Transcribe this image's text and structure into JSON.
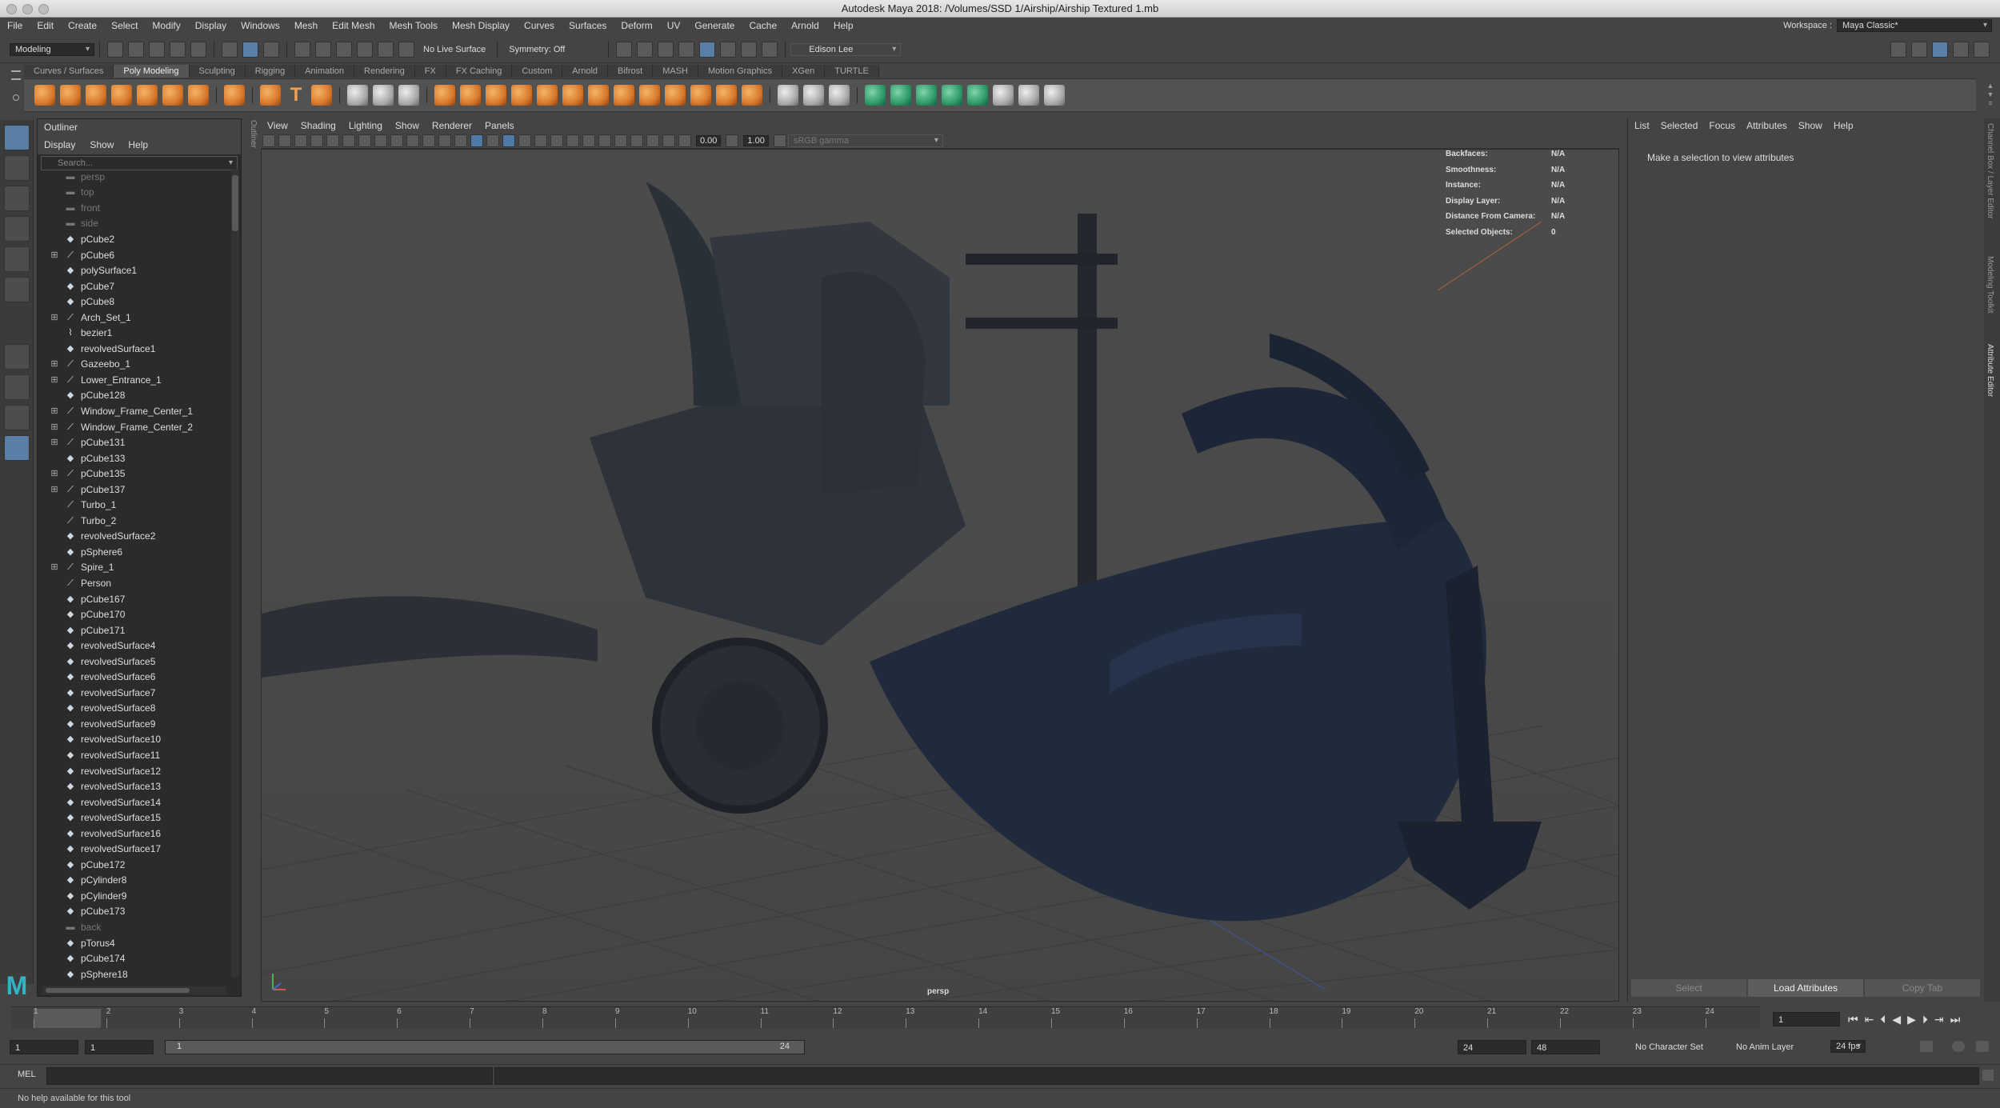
{
  "window": {
    "title": "Autodesk Maya 2018: /Volumes/SSD 1/Airship/Airship Textured 1.mb"
  },
  "menubar": {
    "items": [
      "File",
      "Edit",
      "Create",
      "Select",
      "Modify",
      "Display",
      "Windows",
      "Mesh",
      "Edit Mesh",
      "Mesh Tools",
      "Mesh Display",
      "Curves",
      "Surfaces",
      "Deform",
      "UV",
      "Generate",
      "Cache",
      "Arnold",
      "Help"
    ],
    "workspace_label": "Workspace :",
    "workspace_value": "Maya Classic*"
  },
  "statusline": {
    "menuset": "Modeling",
    "live_surface": "No Live Surface",
    "symmetry": "Symmetry: Off",
    "user": "Edison Lee"
  },
  "shelf": {
    "tabs": [
      "Curves / Surfaces",
      "Poly Modeling",
      "Sculpting",
      "Rigging",
      "Animation",
      "Rendering",
      "FX",
      "FX Caching",
      "Custom",
      "Arnold",
      "Bifrost",
      "MASH",
      "Motion Graphics",
      "XGen",
      "TURTLE"
    ],
    "active_tab": "Poly Modeling"
  },
  "outliner": {
    "title": "Outliner",
    "menus": [
      "Display",
      "Show",
      "Help"
    ],
    "search_placeholder": "Search...",
    "items": [
      {
        "name": "persp",
        "type": "camera",
        "expand": false,
        "dim": true
      },
      {
        "name": "top",
        "type": "camera",
        "expand": false,
        "dim": true
      },
      {
        "name": "front",
        "type": "camera",
        "expand": false,
        "dim": true
      },
      {
        "name": "side",
        "type": "camera",
        "expand": false,
        "dim": true
      },
      {
        "name": "pCube2",
        "type": "mesh",
        "expand": false
      },
      {
        "name": "pCube6",
        "type": "group",
        "expand": true
      },
      {
        "name": "polySurface1",
        "type": "mesh",
        "expand": false
      },
      {
        "name": "pCube7",
        "type": "mesh",
        "expand": false
      },
      {
        "name": "pCube8",
        "type": "mesh",
        "expand": false
      },
      {
        "name": "Arch_Set_1",
        "type": "group",
        "expand": true
      },
      {
        "name": "bezier1",
        "type": "curve",
        "expand": false
      },
      {
        "name": "revolvedSurface1",
        "type": "mesh",
        "expand": false
      },
      {
        "name": "Gazeebo_1",
        "type": "group",
        "expand": true
      },
      {
        "name": "Lower_Entrance_1",
        "type": "group",
        "expand": true
      },
      {
        "name": "pCube128",
        "type": "mesh",
        "expand": false
      },
      {
        "name": "Window_Frame_Center_1",
        "type": "group",
        "expand": true
      },
      {
        "name": "Window_Frame_Center_2",
        "type": "group",
        "expand": true
      },
      {
        "name": "pCube131",
        "type": "group",
        "expand": true
      },
      {
        "name": "pCube133",
        "type": "mesh",
        "expand": false
      },
      {
        "name": "pCube135",
        "type": "group",
        "expand": true
      },
      {
        "name": "pCube137",
        "type": "group",
        "expand": true
      },
      {
        "name": "Turbo_1",
        "type": "group",
        "expand": false
      },
      {
        "name": "Turbo_2",
        "type": "group",
        "expand": false
      },
      {
        "name": "revolvedSurface2",
        "type": "mesh",
        "expand": false
      },
      {
        "name": "pSphere6",
        "type": "mesh",
        "expand": false
      },
      {
        "name": "Spire_1",
        "type": "group",
        "expand": true
      },
      {
        "name": "Person",
        "type": "group",
        "expand": false
      },
      {
        "name": "pCube167",
        "type": "mesh",
        "expand": false
      },
      {
        "name": "pCube170",
        "type": "mesh",
        "expand": false
      },
      {
        "name": "pCube171",
        "type": "mesh",
        "expand": false
      },
      {
        "name": "revolvedSurface4",
        "type": "mesh",
        "expand": false
      },
      {
        "name": "revolvedSurface5",
        "type": "mesh",
        "expand": false
      },
      {
        "name": "revolvedSurface6",
        "type": "mesh",
        "expand": false
      },
      {
        "name": "revolvedSurface7",
        "type": "mesh",
        "expand": false
      },
      {
        "name": "revolvedSurface8",
        "type": "mesh",
        "expand": false
      },
      {
        "name": "revolvedSurface9",
        "type": "mesh",
        "expand": false
      },
      {
        "name": "revolvedSurface10",
        "type": "mesh",
        "expand": false
      },
      {
        "name": "revolvedSurface11",
        "type": "mesh",
        "expand": false
      },
      {
        "name": "revolvedSurface12",
        "type": "mesh",
        "expand": false
      },
      {
        "name": "revolvedSurface13",
        "type": "mesh",
        "expand": false
      },
      {
        "name": "revolvedSurface14",
        "type": "mesh",
        "expand": false
      },
      {
        "name": "revolvedSurface15",
        "type": "mesh",
        "expand": false
      },
      {
        "name": "revolvedSurface16",
        "type": "mesh",
        "expand": false
      },
      {
        "name": "revolvedSurface17",
        "type": "mesh",
        "expand": false
      },
      {
        "name": "pCube172",
        "type": "mesh",
        "expand": false
      },
      {
        "name": "pCylinder8",
        "type": "mesh",
        "expand": false
      },
      {
        "name": "pCylinder9",
        "type": "mesh",
        "expand": false
      },
      {
        "name": "pCube173",
        "type": "mesh",
        "expand": false
      },
      {
        "name": "back",
        "type": "camera",
        "expand": false,
        "dim": true
      },
      {
        "name": "pTorus4",
        "type": "mesh",
        "expand": false
      },
      {
        "name": "pCube174",
        "type": "mesh",
        "expand": false
      },
      {
        "name": "pSphere18",
        "type": "mesh",
        "expand": false
      }
    ]
  },
  "viewport": {
    "menus": [
      "View",
      "Shading",
      "Lighting",
      "Show",
      "Renderer",
      "Panels"
    ],
    "exposure": "0.00",
    "gamma": "1.00",
    "colorspace": "sRGB gamma",
    "camera": "persp",
    "hud": [
      {
        "label": "Backfaces:",
        "value": "N/A"
      },
      {
        "label": "Smoothness:",
        "value": "N/A"
      },
      {
        "label": "Instance:",
        "value": "N/A"
      },
      {
        "label": "Display Layer:",
        "value": "N/A"
      },
      {
        "label": "Distance From Camera:",
        "value": "N/A"
      },
      {
        "label": "Selected Objects:",
        "value": "0"
      }
    ]
  },
  "attribute_editor": {
    "menus": [
      "List",
      "Selected",
      "Focus",
      "Attributes",
      "Show",
      "Help"
    ],
    "message": "Make a selection to view attributes",
    "buttons": [
      "Select",
      "Load Attributes",
      "Copy Tab"
    ],
    "side_tabs": [
      "Channel Box / Layer Editor",
      "Modeling Toolkit",
      "Attribute Editor"
    ]
  },
  "timeline": {
    "ticks": [
      "1",
      "2",
      "3",
      "4",
      "5",
      "6",
      "7",
      "8",
      "9",
      "10",
      "11",
      "12",
      "13",
      "14",
      "15",
      "16",
      "17",
      "18",
      "19",
      "20",
      "21",
      "22",
      "23",
      "24"
    ],
    "current_frame": "1"
  },
  "range": {
    "start": "1",
    "playback_start": "1",
    "range_start_label": "1",
    "range_end_label": "24",
    "playback_end": "24",
    "end": "48",
    "character_set": "No Character Set",
    "anim_layer": "No Anim Layer",
    "fps": "24 fps"
  },
  "command_line": {
    "label": "MEL"
  },
  "help_line": {
    "text": "No help available for this tool"
  },
  "colors": {
    "accent": "#5a7fa6",
    "shelf_orange": "#d9782c",
    "maya_logo": "#2fb5c4"
  }
}
